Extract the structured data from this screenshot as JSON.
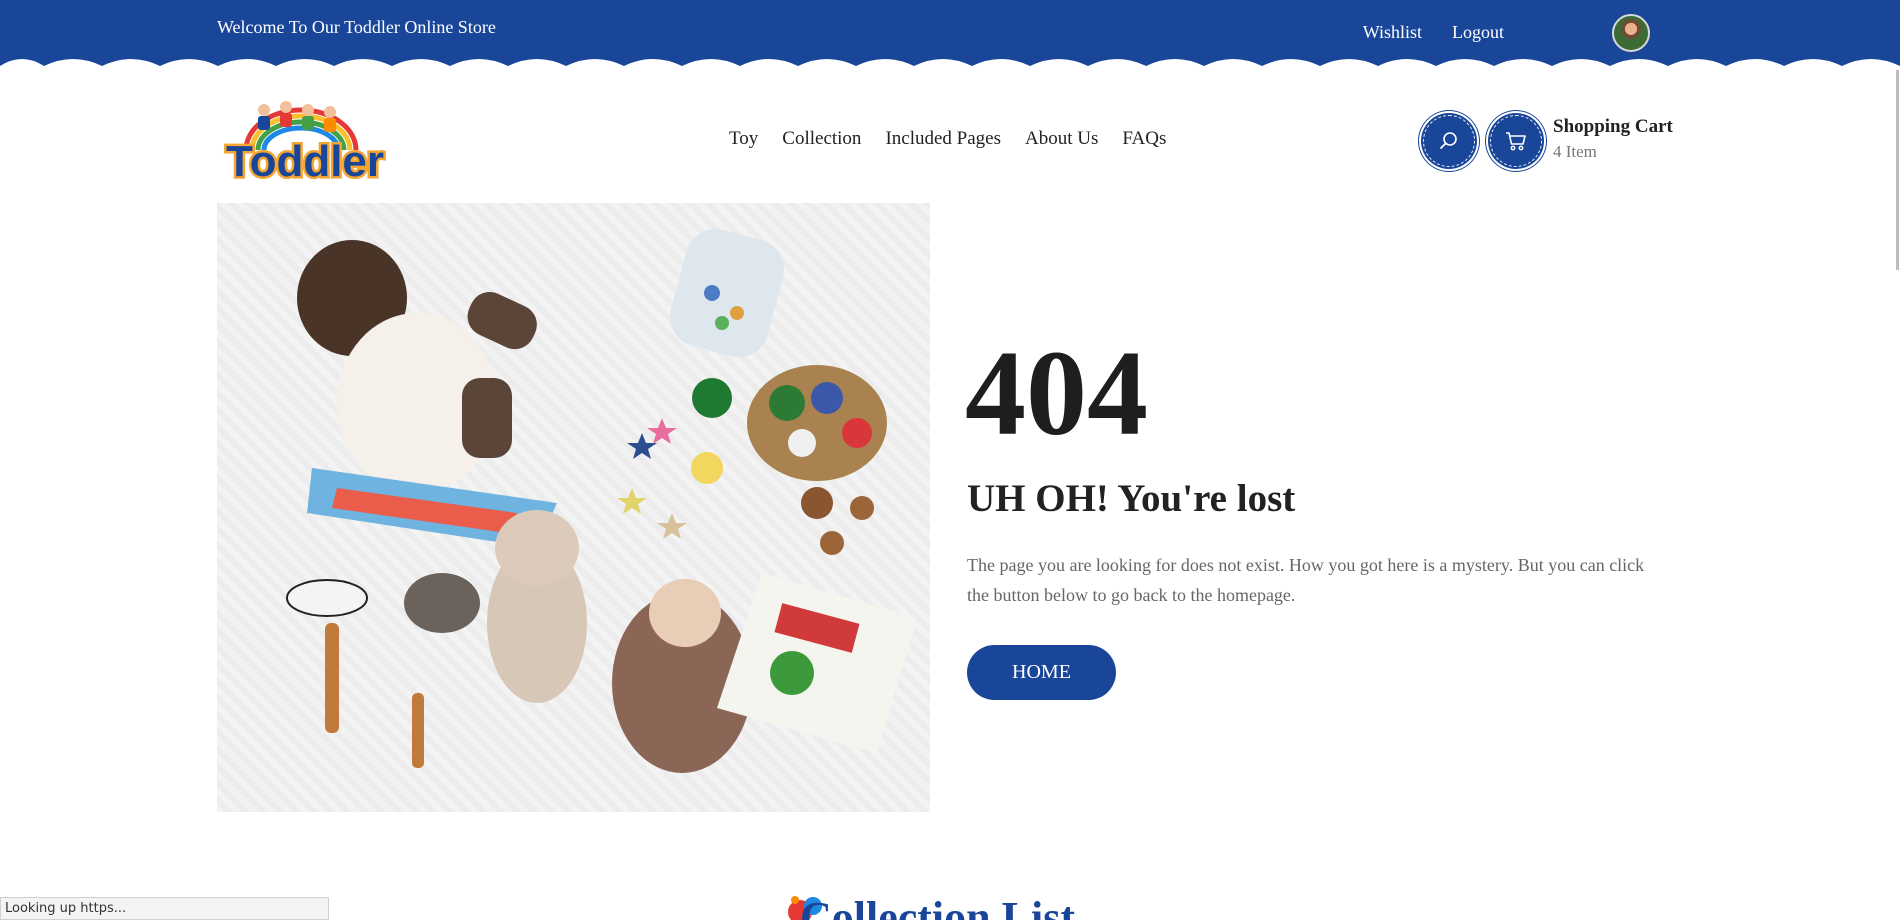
{
  "topbar": {
    "welcome": "Welcome To Our Toddler Online Store",
    "links": [
      "Wishlist",
      "Logout"
    ],
    "bg_color": "#1a4699"
  },
  "header": {
    "logo_text": "Toddler",
    "nav": [
      "Toy",
      "Collection",
      "Included Pages",
      "About Us",
      "FAQs"
    ],
    "cart": {
      "title": "Shopping Cart",
      "count": "4 Item"
    },
    "icons": [
      "search-icon",
      "cart-icon"
    ]
  },
  "error": {
    "code": "404",
    "title": "UH OH! You're lost",
    "text": "The page you are looking for does not exist. How you got here is a mystery. But you can click the button below to go back to the homepage.",
    "button": "HOME"
  },
  "section": {
    "title": "Collection List"
  },
  "status": "Looking up https..."
}
